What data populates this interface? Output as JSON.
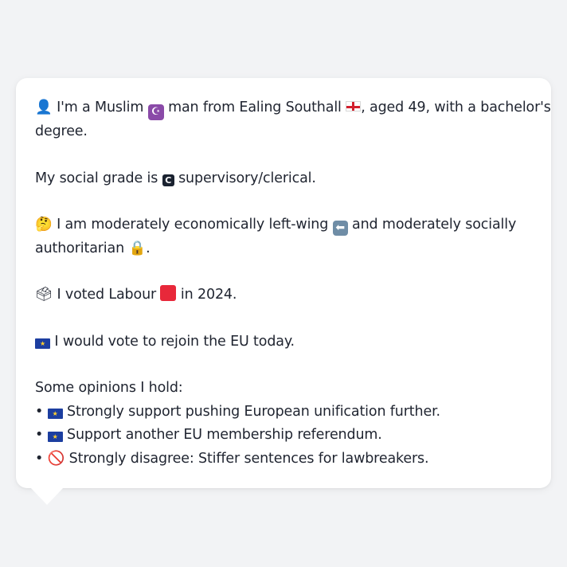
{
  "bubble": {
    "intro": {
      "line1_a": "I'm a Muslim",
      "line1_b": "man from Ealing Southall",
      "line1_c": ", aged 49, with a bachelor's",
      "line2": "degree."
    },
    "grade": {
      "prefix": "My social grade is",
      "badge": "C",
      "suffix": "supervisory/clerical."
    },
    "politics": {
      "line1_a": "I am moderately economically left-wing",
      "line1_b": "and moderately socially",
      "line2": "authoritarian",
      "line2_end": "."
    },
    "vote": {
      "prefix": "I voted Labour",
      "suffix": "in 2024."
    },
    "eu": {
      "text": "I would vote to rejoin the EU today."
    },
    "opinions": {
      "heading": "Some opinions I hold:",
      "bullet": "•",
      "items": [
        {
          "icon": "eu-flag-icon",
          "text": "Strongly support pushing European unification further."
        },
        {
          "icon": "eu-flag-icon",
          "text": "Support another EU membership referendum."
        },
        {
          "icon": "prohibited-icon",
          "text": "Strongly disagree: Stiffer sentences for lawbreakers."
        }
      ]
    }
  },
  "colors": {
    "background": "#f2f3f5",
    "card": "#ffffff",
    "text": "#1f2430",
    "labour_red": "#e8283a",
    "eu_blue": "#1c3ea0"
  }
}
